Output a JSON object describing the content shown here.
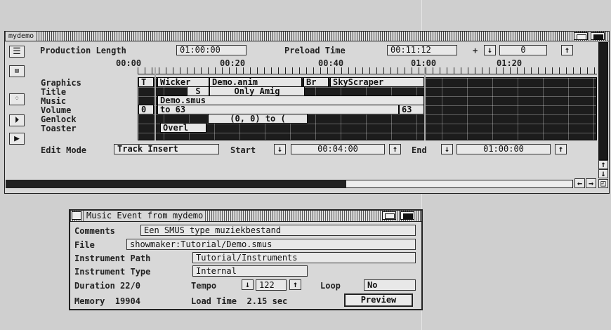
{
  "main_window": {
    "title": "mydemo",
    "production_length_label": "Production Length",
    "production_length_value": "01:00:00",
    "preload_time_label": "Preload Time",
    "preload_time_value": "00:11:12",
    "preload_plus": "+",
    "frame_value": "0",
    "timeline_ticks": [
      "00:00",
      "00:20",
      "00:40",
      "01:00",
      "01:20"
    ],
    "tracks": [
      "Graphics",
      "Title",
      "Music",
      "Volume",
      "Genlock",
      "Toaster"
    ],
    "events": {
      "graphics_t": "T",
      "graphics_wicker": "Wicker",
      "graphics_demo": "Demo.anim",
      "graphics_br": "Br",
      "graphics_sky": "SkyScraper",
      "title_s": "S",
      "title_only": "Only Amig",
      "music_demo": "Demo.smus",
      "volume_from": "0",
      "volume_to": "to 63",
      "volume_end": "63",
      "genlock_range": "(0, 0) to (",
      "toaster_overl": "Overl"
    },
    "edit_mode_label": "Edit Mode",
    "edit_mode_value": "Track Insert",
    "start_label": "Start",
    "start_value": "00:04:00",
    "end_label": "End",
    "end_value": "01:00:00",
    "scroll_fraction": 0.6
  },
  "dialog": {
    "title": "Music Event from mydemo",
    "comments_label": "Comments",
    "comments_value": "Een SMUS type muziekbestand",
    "file_label": "File",
    "file_value": "showmaker:Tutorial/Demo.smus",
    "instrument_path_label": "Instrument Path",
    "instrument_path_value": "Tutorial/Instruments",
    "instrument_type_label": "Instrument Type",
    "instrument_type_value": "Internal",
    "duration_text": "Duration 22/0",
    "tempo_label": "Tempo",
    "tempo_value": "122",
    "loop_label": "Loop",
    "loop_value": "No",
    "memory_text": "Memory  19904",
    "load_time_text": "Load Time  2.15 sec",
    "preview_label": "Preview"
  },
  "icons": [
    "down-arrow-icon",
    "up-arrow-icon",
    "play-icon",
    "step-play-icon",
    "close-gadget-icon",
    "depth-gadget-icon"
  ]
}
